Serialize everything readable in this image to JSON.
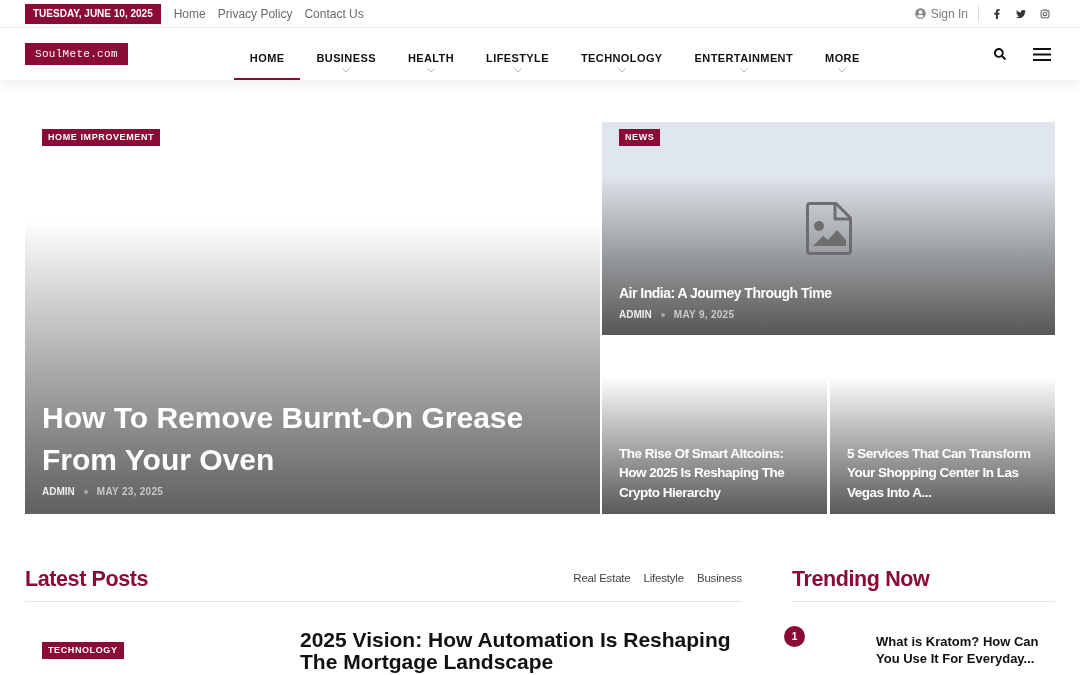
{
  "top_bar": {
    "date": "TUESDAY, JUNE 10, 2025",
    "links": [
      "Home",
      "Privacy Policy",
      "Contact Us"
    ],
    "sign_in": "Sign In"
  },
  "header": {
    "logo": "SoulMete.com",
    "nav": [
      {
        "label": "HOME",
        "selected": true,
        "has_dropdown": false
      },
      {
        "label": "BUSINESS",
        "selected": false,
        "has_dropdown": true
      },
      {
        "label": "HEALTH",
        "selected": false,
        "has_dropdown": true
      },
      {
        "label": "LIFESTYLE",
        "selected": false,
        "has_dropdown": true
      },
      {
        "label": "TECHNOLOGY",
        "selected": false,
        "has_dropdown": true
      },
      {
        "label": "ENTERTAINMENT",
        "selected": false,
        "has_dropdown": true
      },
      {
        "label": "MORE",
        "selected": false,
        "has_dropdown": true
      }
    ]
  },
  "hero": {
    "main": {
      "category": "HOME IMPROVEMENT",
      "title": "How To Remove Burnt-On Grease From Your Oven",
      "author": "ADMIN",
      "date": "MAY 23, 2025"
    },
    "side_top": {
      "category": "NEWS",
      "title": "Air India: A Journey Through Time",
      "author": "ADMIN",
      "date": "MAY 9, 2025"
    },
    "side_bottom": [
      {
        "title": "The Rise Of Smart Altcoins: How 2025 Is Reshaping The Crypto Hierarchy"
      },
      {
        "title": "5 Services That Can Transform Your Shopping Center In Las Vegas Into A..."
      }
    ]
  },
  "latest_posts": {
    "heading": "Latest Posts",
    "filters": [
      "Real Estate",
      "Lifestyle",
      "Business"
    ],
    "posts": [
      {
        "category": "TECHNOLOGY",
        "title": "2025 Vision: How Automation Is Reshaping The Mortgage Landscape"
      }
    ]
  },
  "trending": {
    "heading": "Trending Now",
    "items": [
      {
        "rank": "1",
        "title": "What is Kratom? How Can You Use It For Everyday..."
      }
    ]
  }
}
